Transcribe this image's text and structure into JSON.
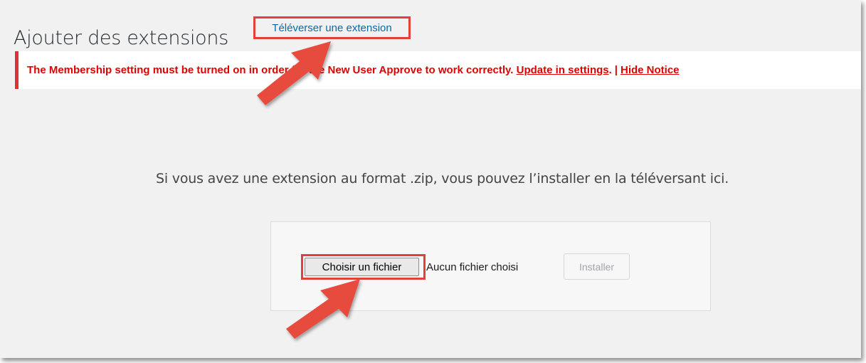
{
  "header": {
    "title": "Ajouter des extensions",
    "upload_link": "Téléverser une extension"
  },
  "notice": {
    "message": "The Membership setting must be turned on in order for the New User Approve to work correctly.",
    "update_link": "Update in settings",
    "after_update": ".",
    "separator": "|",
    "hide_link": "Hide Notice"
  },
  "upload": {
    "help_text": "Si vous avez une extension au format .zip, vous pouvez l’installer en la téléversant ici.",
    "file_button": "Choisir un fichier",
    "file_status": "Aucun fichier choisi",
    "install_button": "Installer"
  },
  "colors": {
    "annotation": "#e0413b",
    "notice_red": "#e00000",
    "link_blue": "#0a6aa6",
    "background": "#f1f1f1"
  },
  "icons": {
    "annotation_arrow": "arrow-pointer-icon"
  }
}
